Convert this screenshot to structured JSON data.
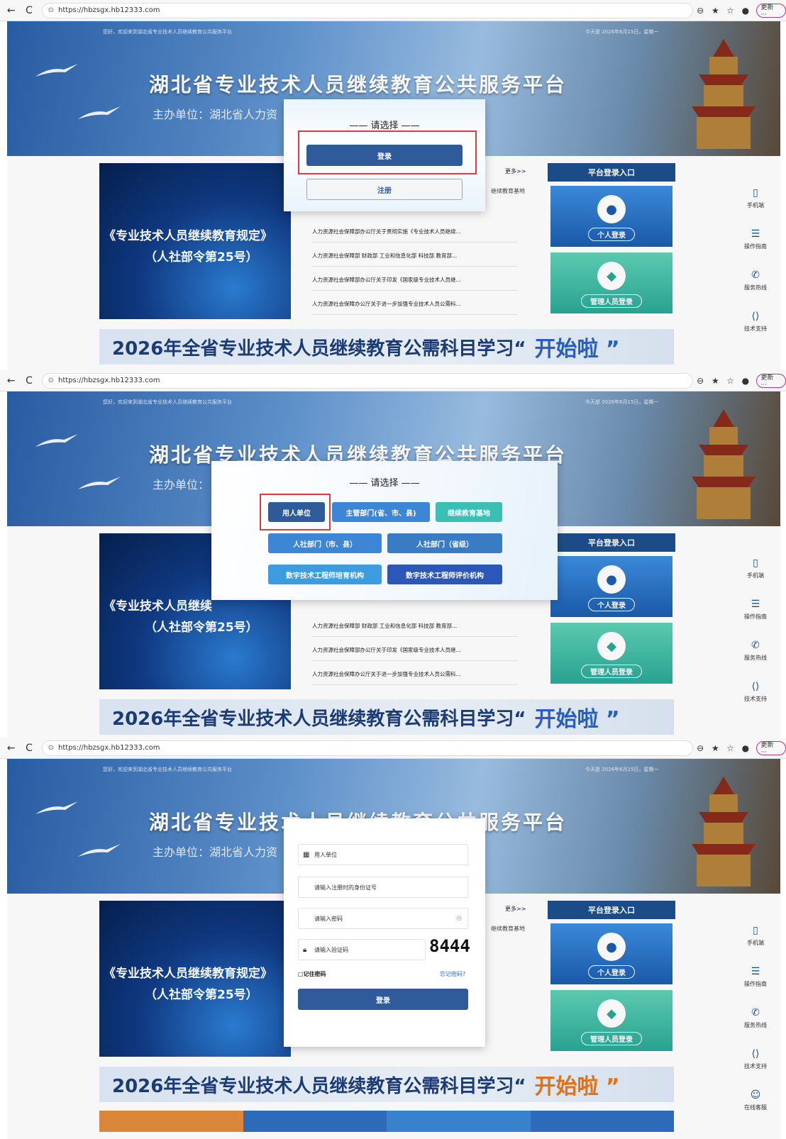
{
  "browser": {
    "back": "←",
    "reload": "C",
    "url": "https://hbzsgx.hb12333.com",
    "update_label": "更新 ···"
  },
  "site": {
    "welcome": "您好，欢迎来到湖北省专业技术人员继续教育公共服务平台",
    "date": "今天是 2026年6月15日，星期一",
    "title": "湖北省专业技术人员继续教育公共服务平台",
    "host": "主办单位：湖北省人力资",
    "host_short": "主办单位：",
    "slide_line1": "《专业技术人员继续教育规定》",
    "slide_line1_short": "《专业技术人员继续",
    "slide_line2": "（人社部令第25号）",
    "more": "更多>>",
    "base_link": "继续教育基地",
    "news": [
      "人力资源社会保障部办公厅关于贯彻实施《专业技术人员继续...",
      "人力资源社会保障部 财政部 工业和信息化部 科技部 教育部...",
      "人力资源社会保障部办公厅关于印发《国家级专业技术人员继...",
      "人力资源社会保障办公厅关于进一步加强专业技术人员公需科..."
    ],
    "login_area_title": "平台登录入口",
    "personal_login": "个人登录",
    "admin_login": "管理人员登录",
    "strip_text": "2026年全省专业技术人员继续教育公需科目学习“",
    "strip_em": "开始啦 ”",
    "rightbar": [
      {
        "icon": "▯",
        "label": "手机端"
      },
      {
        "icon": "☰",
        "label": "操作指南"
      },
      {
        "icon": "✆",
        "label": "服务热线"
      },
      {
        "icon": "⟨⟩",
        "label": "技术支持"
      },
      {
        "icon": "☺",
        "label": "在线客服"
      }
    ]
  },
  "modal1": {
    "title": "—— 请选择 ——",
    "login": "登录",
    "register": "注册"
  },
  "modal2": {
    "title": "—— 请选择 ——",
    "buttons": [
      {
        "label": "用人单位",
        "color": "#2f5b9a"
      },
      {
        "label": "主管部门(省、市、县)",
        "color": "#3d86d6"
      },
      {
        "label": "继续教育基地",
        "color": "#3bbfb4"
      },
      {
        "label": "人社部门（市、县）",
        "color": "#3d86d6"
      },
      {
        "label": "人社部门（省级）",
        "color": "#3a7cc4"
      },
      {
        "label": "数字技术工程师培育机构",
        "color": "#3d9ce0"
      },
      {
        "label": "数字技术工程师评价机构",
        "color": "#2b58b8"
      }
    ]
  },
  "modal3": {
    "unit_type": "用人单位",
    "id_placeholder": "请输入注册时的身份证号",
    "password_placeholder": "请输入密码",
    "captcha_placeholder": "请输入验证码",
    "captcha": "8444",
    "remember": "□记住密码",
    "forgot": "忘记密码?",
    "submit": "登录"
  },
  "colors": {
    "accent": "#2f5b9a",
    "highlight_border": "#e53935",
    "teal": "#3bbfb4"
  }
}
